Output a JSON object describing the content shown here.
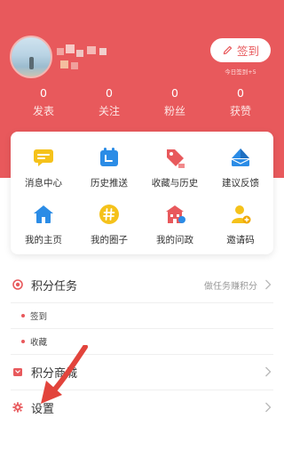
{
  "colors": {
    "brand": "#e8595c",
    "card_bg": "#ffffff",
    "accent_yellow": "#f5c21b",
    "accent_blue": "#2b8ce6",
    "accent_red": "#e8595c",
    "arrow": "#e2443c"
  },
  "profile": {
    "avatar_icon": "avatar-photo"
  },
  "signin": {
    "label": "签到",
    "icon": "pencil-icon",
    "note": "今日签到+5"
  },
  "stats": [
    {
      "value": "0",
      "label": "发表"
    },
    {
      "value": "0",
      "label": "关注"
    },
    {
      "value": "0",
      "label": "粉丝"
    },
    {
      "value": "0",
      "label": "获赞"
    }
  ],
  "grid": [
    {
      "label": "消息中心",
      "icon": "message-icon"
    },
    {
      "label": "历史推送",
      "icon": "calendar-icon"
    },
    {
      "label": "收藏与历史",
      "icon": "tag-icon"
    },
    {
      "label": "建议反馈",
      "icon": "paper-plane-icon"
    },
    {
      "label": "我的主页",
      "icon": "home-icon"
    },
    {
      "label": "我的圈子",
      "icon": "hashtag-icon"
    },
    {
      "label": "我的问政",
      "icon": "building-icon"
    },
    {
      "label": "邀请码",
      "icon": "person-add-icon"
    }
  ],
  "list": {
    "points_task": {
      "title": "积分任务",
      "hint": "做任务赚积分"
    },
    "sub_items": [
      "签到",
      "收藏"
    ],
    "points_mall": {
      "title": "积分商城"
    },
    "settings": {
      "title": "设置"
    }
  }
}
